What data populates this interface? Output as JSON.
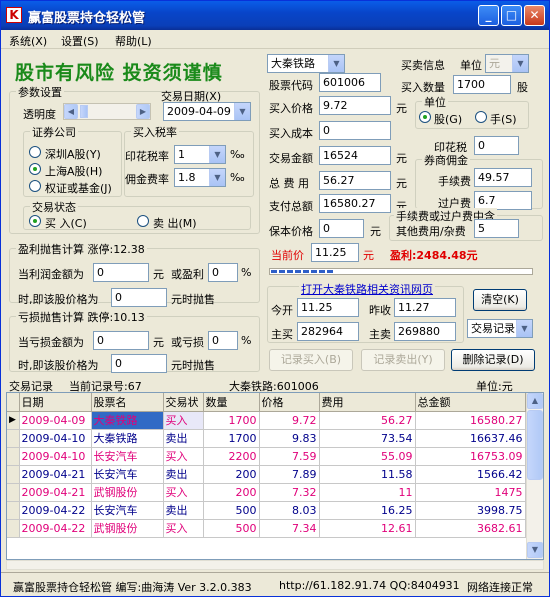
{
  "window": {
    "title": "赢富股票持仓轻松管",
    "icon": "app-logo-icon"
  },
  "menu": [
    "系统(X)",
    "设置(S)",
    "帮助(L)"
  ],
  "slogan": "股市有风险 投资须谨慎",
  "params": {
    "legend": "参数设置",
    "transparency_label": "透明度",
    "trade_date_label": "交易日期(X)",
    "trade_date": "2009-04-09",
    "broker_legend": "证券公司",
    "brokers": [
      "深圳A股(Y)",
      "上海A股(H)",
      "权证或基金(J)"
    ],
    "broker_selected": 1,
    "tax_legend": "买入税率",
    "stamp_tax_label": "印花税率",
    "stamp_tax_value": "1",
    "commission_label": "佣金费率",
    "commission_value": "1.8",
    "permille": "‰",
    "state_legend": "交易状态",
    "buy_label": "买 入(C)",
    "sell_label": "卖 出(M)",
    "state_selected": "buy"
  },
  "profit_calc": {
    "legend": "盈利抛售计算",
    "rise_label": "涨停:12.38",
    "when_profit_label": "当利润金额为",
    "yuan": "元",
    "or_profit_label": "或盈利",
    "percent": "%",
    "price_label": "时,即该股价格为",
    "sell_suffix": "元时抛售",
    "profit_amount": "0",
    "profit_percent": "0",
    "price": "0"
  },
  "loss_calc": {
    "legend": "亏损抛售计算",
    "fall_label": "跌停:10.13",
    "when_loss_label": "当亏损金额为",
    "yuan": "元",
    "or_loss_label": "或亏损",
    "percent": "%",
    "price_label": "时,即该股价格为",
    "sell_suffix": "元时抛售",
    "loss_amount": "0",
    "loss_percent": "0",
    "price": "0"
  },
  "trade": {
    "stock_name": "大秦铁路",
    "trade_info_label": "买卖信息",
    "unit_label": "单位",
    "unit_value": "元",
    "code_label": "股票代码",
    "code": "601006",
    "qty_label": "买入数量",
    "qty": "1700",
    "qty_unit": "股",
    "price_label": "买入价格",
    "price": "9.72",
    "yuan": "元",
    "unit_group": "单位",
    "unit_share": "股(G)",
    "unit_lot": "手(S)",
    "cost_label": "买入成本",
    "cost": "0",
    "stamp_label": "印花税",
    "stamp": "0",
    "amount_label": "交易金额",
    "amount": "16524",
    "fee_group": "券商佣金",
    "total_fee_label": "总 费 用",
    "total_fee": "56.27",
    "handling_label": "手续费",
    "handling": "49.57",
    "paid_label": "支付总额",
    "paid": "16580.27",
    "transfer_label": "过户费",
    "transfer": "6.7",
    "breakeven_label": "保本价格",
    "breakeven": "0",
    "other_group": "手续费或过户费中含",
    "other_label": "其他费用/杂费",
    "other": "5",
    "current_label": "当前价",
    "current": "11.25",
    "profit_text": "盈利:2484.48元"
  },
  "info": {
    "link": "打开大秦铁路相关资讯网页",
    "open_label": "今开",
    "open": "11.25",
    "prev_label": "昨收",
    "prev": "11.27",
    "bid_label": "主买",
    "bid": "282964",
    "ask_label": "主卖",
    "ask": "269880",
    "clear_btn": "清空(K)",
    "record_select": "交易记录"
  },
  "actions": {
    "record_buy": "记录买入(B)",
    "record_sell": "记录卖出(Y)",
    "delete": "删除记录(D)"
  },
  "records": {
    "title": "交易记录",
    "current_no": "当前记录号:67",
    "stock": "大秦铁路:601006",
    "unit": "单位:元",
    "columns": [
      "日期",
      "股票名",
      "交易状",
      "数量",
      "价格",
      "费用",
      "总金额"
    ],
    "rows": [
      {
        "date": "2009-04-09",
        "name": "大秦铁路",
        "state": "买入",
        "qty": "1700",
        "price": "9.72",
        "fee": "56.27",
        "total": "16580.27",
        "kind": "buy",
        "selected": true
      },
      {
        "date": "2009-04-10",
        "name": "大秦铁路",
        "state": "卖出",
        "qty": "1700",
        "price": "9.83",
        "fee": "73.54",
        "total": "16637.46",
        "kind": "sell",
        "selected": false
      },
      {
        "date": "2009-04-10",
        "name": "长安汽车",
        "state": "买入",
        "qty": "2200",
        "price": "7.59",
        "fee": "55.09",
        "total": "16753.09",
        "kind": "buy",
        "selected": false
      },
      {
        "date": "2009-04-21",
        "name": "长安汽车",
        "state": "卖出",
        "qty": "200",
        "price": "7.89",
        "fee": "11.58",
        "total": "1566.42",
        "kind": "sell",
        "selected": false
      },
      {
        "date": "2009-04-21",
        "name": "武钢股份",
        "state": "买入",
        "qty": "200",
        "price": "7.32",
        "fee": "11",
        "total": "1475",
        "kind": "buy",
        "selected": false
      },
      {
        "date": "2009-04-22",
        "name": "长安汽车",
        "state": "卖出",
        "qty": "500",
        "price": "8.03",
        "fee": "16.25",
        "total": "3998.75",
        "kind": "sell",
        "selected": false
      },
      {
        "date": "2009-04-22",
        "name": "武钢股份",
        "state": "买入",
        "qty": "500",
        "price": "7.34",
        "fee": "12.61",
        "total": "3682.61",
        "kind": "buy",
        "selected": false
      }
    ]
  },
  "status": {
    "app": "赢富股票持仓轻松管 编写:曲海涛 Ver 3.2.0.383",
    "url": "http://61.182.91.74 QQ:8404931",
    "net": "网络连接正常"
  },
  "colors": {
    "buy": "#e0007a",
    "sell": "#00008b",
    "green": "#1a8a1a",
    "red": "#e00000",
    "blue": "#0000cc"
  }
}
